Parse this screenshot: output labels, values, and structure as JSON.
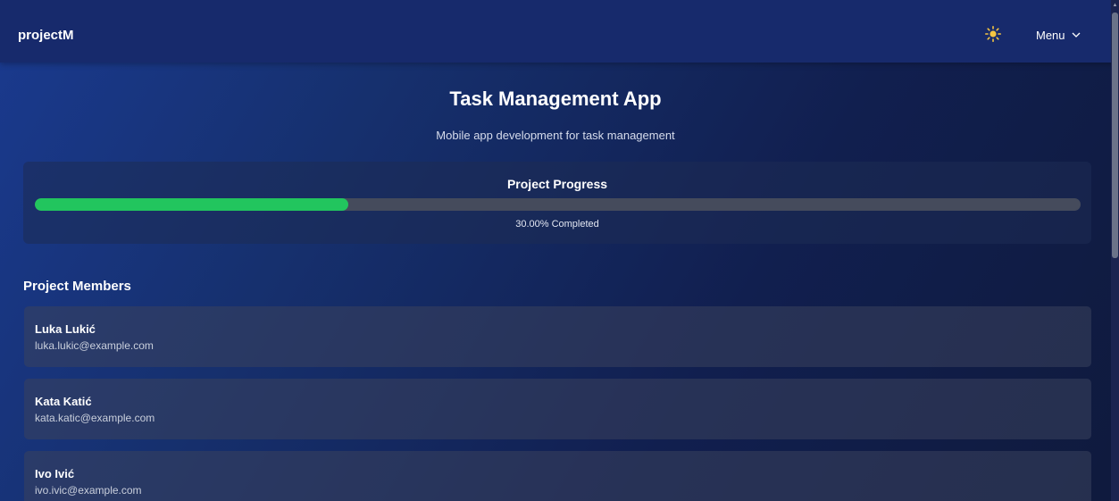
{
  "header": {
    "brand": "projectM",
    "menu_label": "Menu",
    "theme_icon": "sun-icon",
    "menu_icon": "chevron-down-icon",
    "sun_color": "#f5c542"
  },
  "project": {
    "title": "Task Management App",
    "description": "Mobile app development for task management"
  },
  "progress": {
    "title": "Project Progress",
    "percent": 30,
    "label": "30.00% Completed",
    "bar_color": "#22c55e"
  },
  "members": {
    "title": "Project Members",
    "items": [
      {
        "name": "Luka Lukić",
        "email": "luka.lukic@example.com"
      },
      {
        "name": "Kata Katić",
        "email": "kata.katic@example.com"
      },
      {
        "name": "Ivo Ivić",
        "email": "ivo.ivic@example.com"
      }
    ]
  }
}
